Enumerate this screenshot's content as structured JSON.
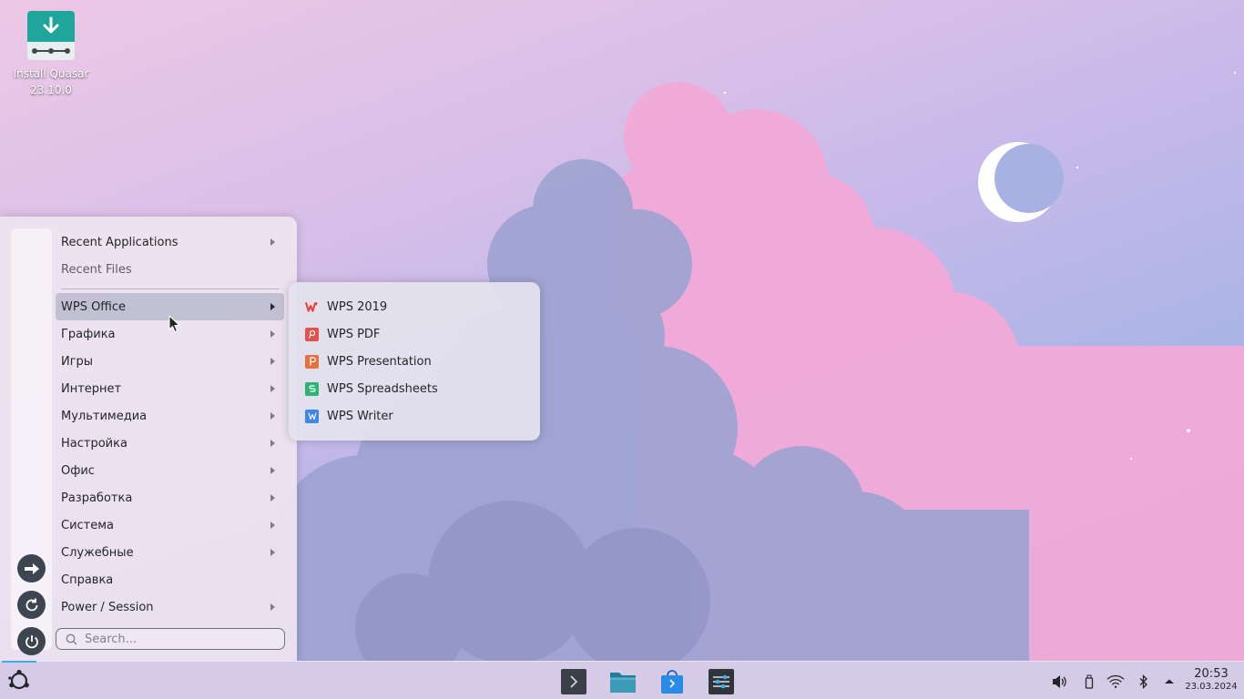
{
  "desktop": {
    "icons": [
      {
        "label": "Install Quasar 23.10.0",
        "icon": "download-installer-icon"
      }
    ]
  },
  "app_menu": {
    "items": [
      {
        "label": "Recent Applications",
        "has_submenu": true
      },
      {
        "label": "Recent Files",
        "has_submenu": false
      },
      {
        "label": "WPS Office",
        "has_submenu": true,
        "active": true
      },
      {
        "label": "Графика",
        "has_submenu": true
      },
      {
        "label": "Игры",
        "has_submenu": true
      },
      {
        "label": "Интернет",
        "has_submenu": true
      },
      {
        "label": "Мультимедиа",
        "has_submenu": true
      },
      {
        "label": "Настройка",
        "has_submenu": true
      },
      {
        "label": "Офис",
        "has_submenu": true
      },
      {
        "label": "Разработка",
        "has_submenu": true
      },
      {
        "label": "Система",
        "has_submenu": true
      },
      {
        "label": "Служебные",
        "has_submenu": true
      },
      {
        "label": "Справка",
        "has_submenu": false
      },
      {
        "label": "Power / Session",
        "has_submenu": true
      }
    ],
    "sidebar": [
      "logout-arrow-icon",
      "restart-icon",
      "power-icon"
    ],
    "search": {
      "placeholder": "Search...",
      "value": ""
    }
  },
  "wps_submenu": {
    "items": [
      {
        "label": "WPS 2019",
        "icon": "wps-office-icon",
        "color": "#e8413a"
      },
      {
        "label": "WPS PDF",
        "icon": "wps-pdf-icon",
        "color": "#e0524a"
      },
      {
        "label": "WPS Presentation",
        "icon": "wps-presentation-icon",
        "color": "#e8703e"
      },
      {
        "label": "WPS Spreadsheets",
        "icon": "wps-spreadsheets-icon",
        "color": "#2bb472"
      },
      {
        "label": "WPS Writer",
        "icon": "wps-writer-icon",
        "color": "#3f87e6"
      }
    ]
  },
  "taskbar": {
    "pinned": [
      "terminal-icon",
      "file-manager-icon",
      "software-store-icon",
      "settings-icon"
    ],
    "tray": [
      "volume-icon",
      "usb-icon",
      "wifi-icon",
      "bluetooth-icon",
      "tray-expand-icon"
    ],
    "clock": {
      "time": "20:53",
      "date": "23.03.2024"
    }
  },
  "colors": {
    "accent": "#3daee9",
    "menu_active": "#76809e"
  }
}
